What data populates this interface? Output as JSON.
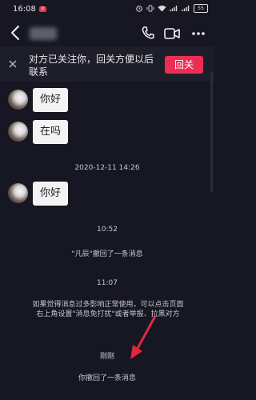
{
  "status_bar": {
    "time": "16:08",
    "app_badge": "D",
    "battery": "55"
  },
  "header": {
    "contact_name": "",
    "icons": [
      "back-arrow-icon",
      "phone-icon",
      "video-icon",
      "more-icon"
    ]
  },
  "banner": {
    "text": "对方已关注你，回关方便以后联系",
    "button_label": "回关"
  },
  "messages": [
    {
      "type": "incoming",
      "text": "你好"
    },
    {
      "type": "incoming",
      "text": "在吗"
    },
    {
      "type": "timestamp",
      "text": "2020-12-11 14:26"
    },
    {
      "type": "incoming",
      "text": "你好"
    },
    {
      "type": "timestamp",
      "text": "10:52"
    },
    {
      "type": "system",
      "text": "\"凡辰\"撤回了一条消息"
    },
    {
      "type": "timestamp",
      "text": "11:07"
    },
    {
      "type": "tip",
      "text": "如果觉得消息过多影响正常使用，可以点击页面右上角设置\"消息免打扰\"或者举报、拉黑对方"
    },
    {
      "type": "timestamp",
      "text": "刚刚"
    },
    {
      "type": "system",
      "text": "你撤回了一条消息"
    }
  ],
  "colors": {
    "background": "#161722",
    "banner_bg": "#1d1e2a",
    "accent": "#ee2d55",
    "bubble": "#f3f3f3",
    "annotation_arrow": "#e3263b"
  }
}
